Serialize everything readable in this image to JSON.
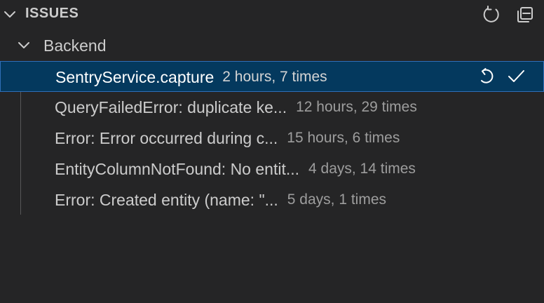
{
  "section": {
    "title": "ISSUES",
    "actions": [
      {
        "icon": "refresh-icon"
      },
      {
        "icon": "collapse-all-icon"
      }
    ]
  },
  "group": {
    "label": "Backend",
    "expanded": true
  },
  "issues": [
    {
      "title": "SentryService.capture",
      "meta": "2 hours, 7 times",
      "selected": true
    },
    {
      "title": "QueryFailedError: duplicate ke...",
      "meta": "12 hours, 29 times",
      "selected": false
    },
    {
      "title": "Error: Error occurred during c...",
      "meta": "15 hours, 6 times",
      "selected": false
    },
    {
      "title": "EntityColumnNotFound: No entit...",
      "meta": "4 days, 14 times",
      "selected": false
    },
    {
      "title": "Error: Created entity (name: \"...",
      "meta": "5 days, 1 times",
      "selected": false
    }
  ],
  "row_actions": [
    {
      "icon": "undo-icon"
    },
    {
      "icon": "check-icon"
    }
  ],
  "colors": {
    "background": "#252526",
    "selection": "#04395e",
    "selection_border": "#2f6fb8",
    "text": "#cccccc",
    "meta_text": "#9d9d9d"
  }
}
